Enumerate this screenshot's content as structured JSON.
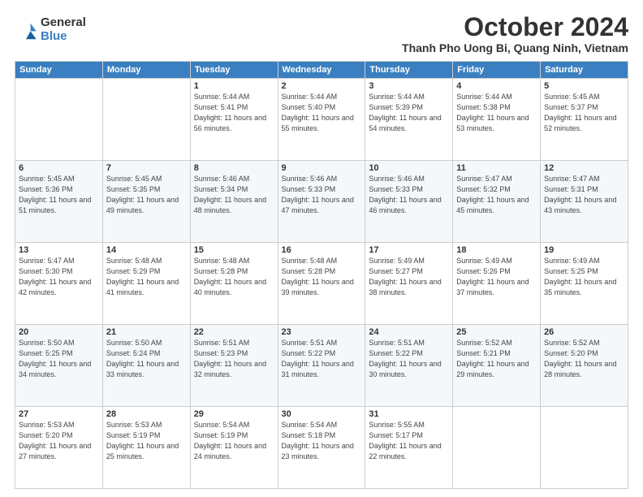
{
  "logo": {
    "general": "General",
    "blue": "Blue"
  },
  "header": {
    "month": "October 2024",
    "location": "Thanh Pho Uong Bi, Quang Ninh, Vietnam"
  },
  "days_of_week": [
    "Sunday",
    "Monday",
    "Tuesday",
    "Wednesday",
    "Thursday",
    "Friday",
    "Saturday"
  ],
  "weeks": [
    [
      {
        "day": "",
        "info": ""
      },
      {
        "day": "",
        "info": ""
      },
      {
        "day": "1",
        "info": "Sunrise: 5:44 AM\nSunset: 5:41 PM\nDaylight: 11 hours and 56 minutes."
      },
      {
        "day": "2",
        "info": "Sunrise: 5:44 AM\nSunset: 5:40 PM\nDaylight: 11 hours and 55 minutes."
      },
      {
        "day": "3",
        "info": "Sunrise: 5:44 AM\nSunset: 5:39 PM\nDaylight: 11 hours and 54 minutes."
      },
      {
        "day": "4",
        "info": "Sunrise: 5:44 AM\nSunset: 5:38 PM\nDaylight: 11 hours and 53 minutes."
      },
      {
        "day": "5",
        "info": "Sunrise: 5:45 AM\nSunset: 5:37 PM\nDaylight: 11 hours and 52 minutes."
      }
    ],
    [
      {
        "day": "6",
        "info": "Sunrise: 5:45 AM\nSunset: 5:36 PM\nDaylight: 11 hours and 51 minutes."
      },
      {
        "day": "7",
        "info": "Sunrise: 5:45 AM\nSunset: 5:35 PM\nDaylight: 11 hours and 49 minutes."
      },
      {
        "day": "8",
        "info": "Sunrise: 5:46 AM\nSunset: 5:34 PM\nDaylight: 11 hours and 48 minutes."
      },
      {
        "day": "9",
        "info": "Sunrise: 5:46 AM\nSunset: 5:33 PM\nDaylight: 11 hours and 47 minutes."
      },
      {
        "day": "10",
        "info": "Sunrise: 5:46 AM\nSunset: 5:33 PM\nDaylight: 11 hours and 46 minutes."
      },
      {
        "day": "11",
        "info": "Sunrise: 5:47 AM\nSunset: 5:32 PM\nDaylight: 11 hours and 45 minutes."
      },
      {
        "day": "12",
        "info": "Sunrise: 5:47 AM\nSunset: 5:31 PM\nDaylight: 11 hours and 43 minutes."
      }
    ],
    [
      {
        "day": "13",
        "info": "Sunrise: 5:47 AM\nSunset: 5:30 PM\nDaylight: 11 hours and 42 minutes."
      },
      {
        "day": "14",
        "info": "Sunrise: 5:48 AM\nSunset: 5:29 PM\nDaylight: 11 hours and 41 minutes."
      },
      {
        "day": "15",
        "info": "Sunrise: 5:48 AM\nSunset: 5:28 PM\nDaylight: 11 hours and 40 minutes."
      },
      {
        "day": "16",
        "info": "Sunrise: 5:48 AM\nSunset: 5:28 PM\nDaylight: 11 hours and 39 minutes."
      },
      {
        "day": "17",
        "info": "Sunrise: 5:49 AM\nSunset: 5:27 PM\nDaylight: 11 hours and 38 minutes."
      },
      {
        "day": "18",
        "info": "Sunrise: 5:49 AM\nSunset: 5:26 PM\nDaylight: 11 hours and 37 minutes."
      },
      {
        "day": "19",
        "info": "Sunrise: 5:49 AM\nSunset: 5:25 PM\nDaylight: 11 hours and 35 minutes."
      }
    ],
    [
      {
        "day": "20",
        "info": "Sunrise: 5:50 AM\nSunset: 5:25 PM\nDaylight: 11 hours and 34 minutes."
      },
      {
        "day": "21",
        "info": "Sunrise: 5:50 AM\nSunset: 5:24 PM\nDaylight: 11 hours and 33 minutes."
      },
      {
        "day": "22",
        "info": "Sunrise: 5:51 AM\nSunset: 5:23 PM\nDaylight: 11 hours and 32 minutes."
      },
      {
        "day": "23",
        "info": "Sunrise: 5:51 AM\nSunset: 5:22 PM\nDaylight: 11 hours and 31 minutes."
      },
      {
        "day": "24",
        "info": "Sunrise: 5:51 AM\nSunset: 5:22 PM\nDaylight: 11 hours and 30 minutes."
      },
      {
        "day": "25",
        "info": "Sunrise: 5:52 AM\nSunset: 5:21 PM\nDaylight: 11 hours and 29 minutes."
      },
      {
        "day": "26",
        "info": "Sunrise: 5:52 AM\nSunset: 5:20 PM\nDaylight: 11 hours and 28 minutes."
      }
    ],
    [
      {
        "day": "27",
        "info": "Sunrise: 5:53 AM\nSunset: 5:20 PM\nDaylight: 11 hours and 27 minutes."
      },
      {
        "day": "28",
        "info": "Sunrise: 5:53 AM\nSunset: 5:19 PM\nDaylight: 11 hours and 25 minutes."
      },
      {
        "day": "29",
        "info": "Sunrise: 5:54 AM\nSunset: 5:19 PM\nDaylight: 11 hours and 24 minutes."
      },
      {
        "day": "30",
        "info": "Sunrise: 5:54 AM\nSunset: 5:18 PM\nDaylight: 11 hours and 23 minutes."
      },
      {
        "day": "31",
        "info": "Sunrise: 5:55 AM\nSunset: 5:17 PM\nDaylight: 11 hours and 22 minutes."
      },
      {
        "day": "",
        "info": ""
      },
      {
        "day": "",
        "info": ""
      }
    ]
  ]
}
